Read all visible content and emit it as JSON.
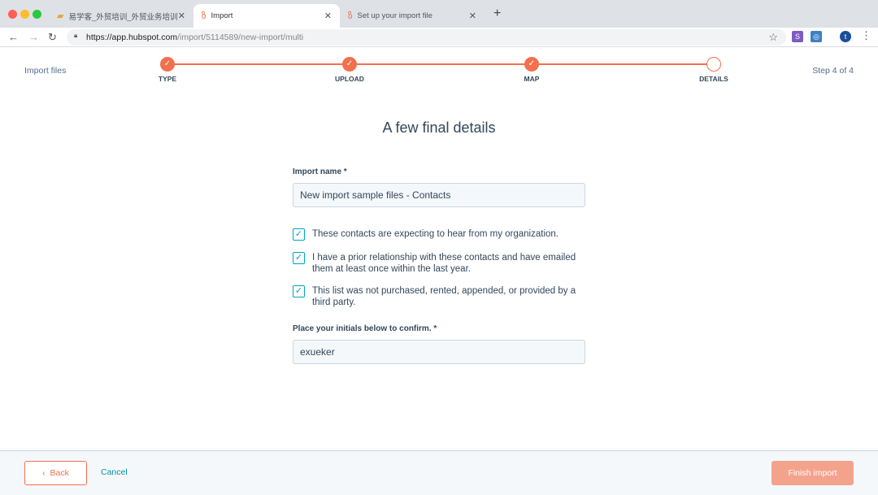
{
  "browser": {
    "tabs": [
      {
        "title": "易学客_外贸培训_外贸业务培训"
      },
      {
        "title": "Import"
      },
      {
        "title": "Set up your import file"
      }
    ],
    "url_domain": "https://app.hubspot.com",
    "url_path": "/import/5114589/new-import/multi",
    "profile_initial": "t",
    "ext1": "S"
  },
  "header": {
    "title": "Import files",
    "step_indicator": "Step 4 of 4",
    "steps": [
      {
        "label": "TYPE",
        "done": true
      },
      {
        "label": "UPLOAD",
        "done": true
      },
      {
        "label": "MAP",
        "done": true
      },
      {
        "label": "DETAILS",
        "done": false
      }
    ]
  },
  "main": {
    "heading": "A few final details",
    "import_name_label": "Import name *",
    "import_name_value": "New import sample files - Contacts",
    "checkboxes": [
      {
        "label": "These contacts are expecting to hear from my organization.",
        "checked": true
      },
      {
        "label": "I have a prior relationship with these contacts and have emailed them at least once within the last year.",
        "checked": true
      },
      {
        "label": "This list was not purchased, rented, appended, or provided by a third party.",
        "checked": true
      }
    ],
    "initials_label": "Place your initials below to confirm. *",
    "initials_value": "exueker"
  },
  "footer": {
    "back": "Back",
    "cancel": "Cancel",
    "finish": "Finish import"
  },
  "colors": {
    "accent": "#f2704e",
    "teal": "#00a4bd"
  }
}
